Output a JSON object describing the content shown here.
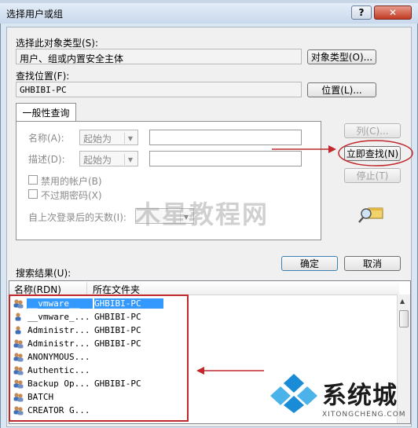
{
  "window": {
    "title": "选择用户或组",
    "help_label": "?",
    "close_label": "✕"
  },
  "object_type": {
    "label": "选择此对象类型(S):",
    "value": "用户、组或内置安全主体",
    "button": "对象类型(O)..."
  },
  "location": {
    "label": "查找位置(F):",
    "value": "GHBIBI-PC",
    "button": "位置(L)..."
  },
  "query": {
    "tab": "一般性查询",
    "name_label": "名称(A):",
    "name_op": "起始为",
    "desc_label": "描述(D):",
    "desc_op": "起始为",
    "disabled_accounts": "禁用的帐户(B)",
    "no_expire_pwd": "不过期密码(X)",
    "days_label": "自上次登录后的天数(I):"
  },
  "buttons": {
    "columns": "列(C)...",
    "find_now": "立即查找(N)",
    "stop": "停止(T)",
    "ok": "确定",
    "cancel": "取消"
  },
  "results": {
    "label": "搜索结果(U):",
    "columns": [
      "名称(RDN)",
      "所在文件夹"
    ],
    "rows": [
      {
        "name": "__vmware__",
        "folder": "GHBIBI-PC",
        "icon": "group-icon",
        "selected": true
      },
      {
        "name": "__vmware_...",
        "folder": "GHBIBI-PC",
        "icon": "user-icon",
        "selected": false
      },
      {
        "name": "Administr...",
        "folder": "GHBIBI-PC",
        "icon": "user-icon",
        "selected": false
      },
      {
        "name": "Administr...",
        "folder": "GHBIBI-PC",
        "icon": "group-icon",
        "selected": false
      },
      {
        "name": "ANONYMOUS...",
        "folder": "",
        "icon": "group-icon",
        "selected": false
      },
      {
        "name": "Authentic...",
        "folder": "",
        "icon": "group-icon",
        "selected": false
      },
      {
        "name": "Backup Op...",
        "folder": "GHBIBI-PC",
        "icon": "group-icon",
        "selected": false
      },
      {
        "name": "BATCH",
        "folder": "",
        "icon": "group-icon",
        "selected": false
      },
      {
        "name": "CREATOR G...",
        "folder": "",
        "icon": "group-icon",
        "selected": false
      }
    ]
  },
  "watermarks": {
    "center": "木星教程网",
    "brand": "系统城",
    "url": "XITONGCHENG.COM"
  },
  "colors": {
    "annotation": "#c0282c",
    "selection": "#3399ff",
    "brand_blue": "#1a8bd6"
  }
}
